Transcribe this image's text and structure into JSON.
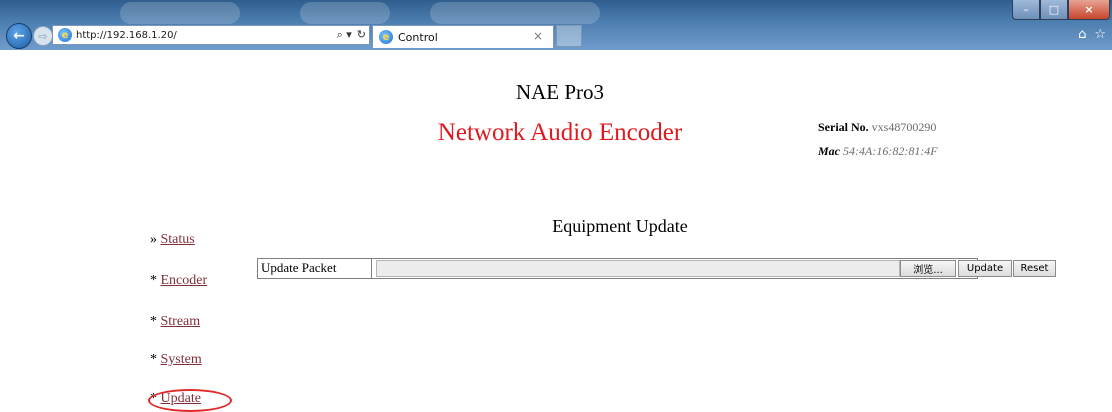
{
  "browser": {
    "url": "http://192.168.1.20/",
    "tab_title": "Control",
    "tab_close": "×",
    "search_glyph": "⌕ ▾",
    "refresh_glyph": "↻",
    "back_glyph": "←",
    "forward_glyph": "⇨",
    "home_glyph": "⌂",
    "favorites_glyph": "☆",
    "window": {
      "minimize": "–",
      "maximize": "□",
      "close": "×"
    }
  },
  "header": {
    "title": "NAE Pro3",
    "subtitle": "Network Audio Encoder",
    "serial_label": "Serial No.",
    "serial_value": "vxs48700290",
    "mac_label": "Mac",
    "mac_value": "54:4A:16:82:81:4F"
  },
  "sidebar": {
    "items": [
      {
        "prefix": "»",
        "label": "Status"
      },
      {
        "prefix": "*",
        "label": "Encoder"
      },
      {
        "prefix": "*",
        "label": "Stream"
      },
      {
        "prefix": "*",
        "label": "System"
      },
      {
        "prefix": "*",
        "label": "Update"
      }
    ],
    "highlighted_item": "Update"
  },
  "main": {
    "section_title": "Equipment Update",
    "form": {
      "label": "Update  Packet",
      "file_value": "",
      "browse_label": "浏览...",
      "update_label": "Update",
      "reset_label": "Reset"
    }
  },
  "colors": {
    "subtitle": "#e0191e",
    "nav_link": "#7f2f3a",
    "highlight_ring": "#e02a2a",
    "chrome": "#4d7fb0"
  }
}
